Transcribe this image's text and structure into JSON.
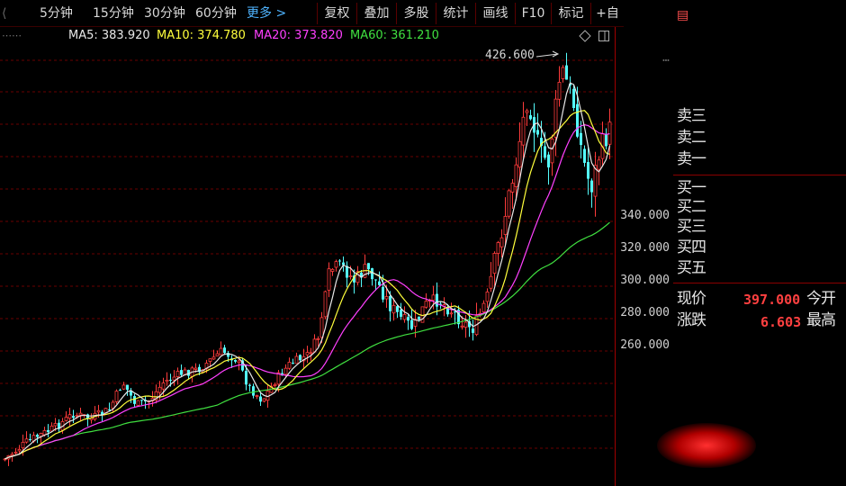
{
  "toolbar": {
    "periods": [
      "5分钟",
      "15分钟",
      "30分钟",
      "60分钟"
    ],
    "more_label": "更多",
    "buttons": [
      "复权",
      "叠加",
      "多股",
      "统计",
      "画线",
      "F10",
      "标记",
      "+自"
    ]
  },
  "legend": {
    "ma5": "MA5: 383.920",
    "ma10": "MA10: 374.780",
    "ma20": "MA20: 373.820",
    "ma60": "MA60: 361.210"
  },
  "colors": {
    "ma5": "#e8e8e8",
    "ma10": "#ffff3c",
    "ma20": "#ff40ff",
    "ma60": "#40e040",
    "up": "#ff3c3c",
    "down": "#54fcfc",
    "grid": "#6a0000",
    "axis": "#a00000"
  },
  "chart": {
    "high_marker": "426.600",
    "y_min": 220,
    "y_max": 430
  },
  "price_axis": {
    "ticks": [
      "340.000",
      "320.000",
      "300.000",
      "280.000",
      "260.000"
    ]
  },
  "order_book": {
    "sell_labels": [
      "卖三",
      "卖二",
      "卖一"
    ],
    "buy_labels": [
      "买一",
      "买二",
      "买三",
      "买四",
      "买五"
    ]
  },
  "quote": {
    "price_label": "现价",
    "price_value": "397.000",
    "open_label": "今开",
    "change_label": "涨跌",
    "change_value": "6.603",
    "high_label": "最高"
  }
}
